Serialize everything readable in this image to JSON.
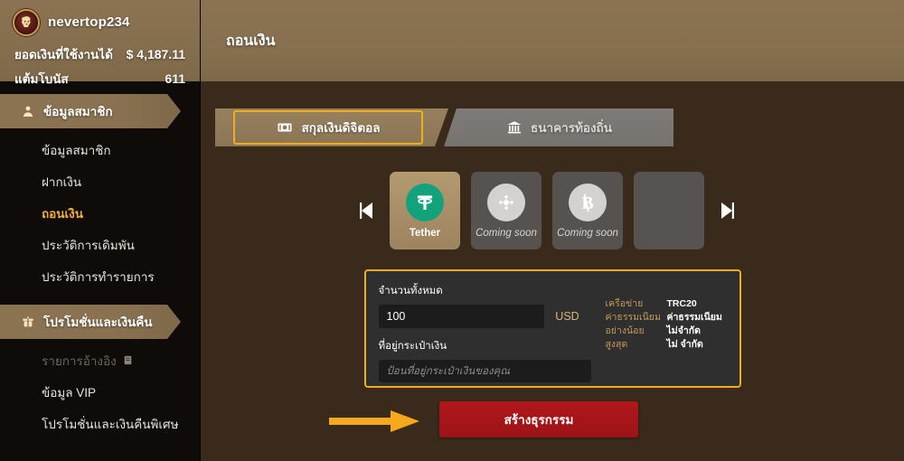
{
  "account": {
    "username": "nevertop234",
    "avatar_icon": "lion-medallion-logo",
    "balance_label": "ยอดเงินที่ใช้งานได้",
    "balance_value": "$ 4,187.11",
    "bonus_label": "แต้มโบนัส",
    "bonus_value": "611"
  },
  "sidebar": {
    "sections": [
      {
        "label": "ข้อมูลสมาชิก",
        "icon": "user-profile-icon",
        "items": [
          {
            "label": "ข้อมูลสมาชิก",
            "state": "normal"
          },
          {
            "label": "ฝากเงิน",
            "state": "normal"
          },
          {
            "label": "ถอนเงิน",
            "state": "active"
          },
          {
            "label": "ประวัติการเดิมพัน",
            "state": "normal"
          },
          {
            "label": "ประวัติการทำรายการ",
            "state": "normal"
          }
        ]
      },
      {
        "label": "โปรโมชั่นและเงินคืน",
        "icon": "gift-promo-icon",
        "items": [
          {
            "label": "รายการอ้างอิง",
            "state": "dim",
            "icon": "clipboard-icon"
          },
          {
            "label": "ข้อมูล VIP",
            "state": "normal"
          },
          {
            "label": "โปรโมชั่นและเงินคืนพิเศษ",
            "state": "normal"
          }
        ]
      }
    ]
  },
  "header": {
    "title": "ถอนเงิน"
  },
  "tabs": [
    {
      "label": "สกุลเงินดิจิตอล",
      "icon": "money-bill-icon",
      "selected": true
    },
    {
      "label": "ธนาคารท้องถิ่น",
      "icon": "bank-icon",
      "selected": false
    }
  ],
  "carousel": {
    "prev_icon": "prev-arrow-icon",
    "next_icon": "next-arrow-icon",
    "coins": [
      {
        "name": "Tether",
        "icon": "tether-icon",
        "selected": true,
        "disabled": false
      },
      {
        "name": "Coming soon",
        "icon": "binance-icon",
        "selected": false,
        "disabled": true
      },
      {
        "name": "Coming soon",
        "icon": "bitcoin-icon",
        "selected": false,
        "disabled": true
      },
      {
        "name": "",
        "icon": "",
        "selected": false,
        "disabled": true
      }
    ]
  },
  "form": {
    "amount_label": "จำนวนทั้งหมด",
    "amount_value": "100",
    "amount_placeholder": "100",
    "currency": "USD",
    "address_label": "ที่อยู่กระเป๋าเงิน",
    "address_value": "",
    "address_placeholder": "ป้อนที่อยู่กระเป๋าเงินของคุณ",
    "info": [
      {
        "key": "เครือข่าย",
        "value": "TRC20",
        "bold": true
      },
      {
        "key": "ค่าธรรมเนียม",
        "value": "ค่าธรรมเนียม",
        "bold": true
      },
      {
        "key": "อย่างน้อย",
        "value": "ไม่จำกัด",
        "bold": true
      },
      {
        "key": "สูงสุด",
        "value": "ไม่ จำกัด",
        "bold": true
      }
    ]
  },
  "submit": {
    "label": "สร้างธุรกรรม",
    "hint_icon": "orange-pointer-arrow"
  },
  "colors": {
    "header_tan": "#87704f",
    "body_brown": "#3a2a1b",
    "sidebar_black": "#0e0b09",
    "accent_gold": "#f0ad1e",
    "active_orange": "#f0ad3c",
    "submit_red": "#a9151a",
    "tether_green": "#12a37c",
    "panel_gray": "#2f2f2f",
    "input_black": "#1c1c1c",
    "coin_gray": "#555250"
  }
}
